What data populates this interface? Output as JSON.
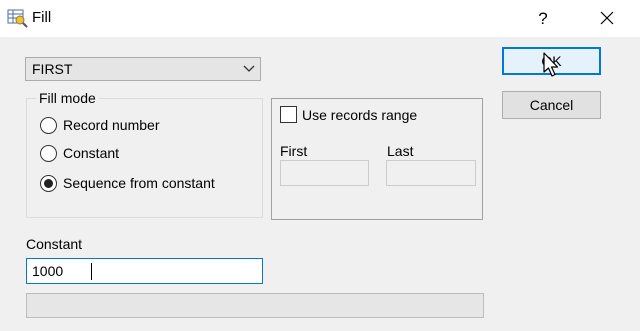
{
  "window": {
    "title": "Fill",
    "help_label": "?",
    "app_icon": "table-fill-app-icon",
    "close_icon": "close-icon"
  },
  "field_select": {
    "value": "FIRST",
    "icon": "chevron-down-icon"
  },
  "fill_mode": {
    "legend": "Fill mode",
    "options": [
      {
        "label": "Record number",
        "checked": false
      },
      {
        "label": "Constant",
        "checked": false
      },
      {
        "label": "Sequence from constant",
        "checked": true
      }
    ]
  },
  "records_range": {
    "checkbox_label": "Use records range",
    "checked": false,
    "first_label": "First",
    "last_label": "Last",
    "first_value": "",
    "last_value": ""
  },
  "constant": {
    "label": "Constant",
    "value": "1000"
  },
  "buttons": {
    "ok": "OK",
    "cancel": "Cancel"
  },
  "progress": {
    "fraction": 0
  },
  "colors": {
    "accent": "#0078d7",
    "dialog_bg": "#f0f0f0"
  }
}
